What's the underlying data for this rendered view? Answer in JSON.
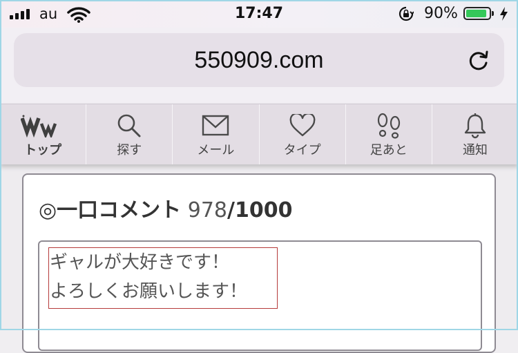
{
  "status_bar": {
    "carrier": "au",
    "time": "17:47",
    "battery_percent": "90%",
    "battery_level": 0.9,
    "signal_bars": 4,
    "battery_color": "#35c85a"
  },
  "browser": {
    "url": "550909.com"
  },
  "nav": {
    "items": [
      {
        "label": "トップ",
        "icon": "ww-logo-icon"
      },
      {
        "label": "探す",
        "icon": "search-icon"
      },
      {
        "label": "メール",
        "icon": "mail-icon"
      },
      {
        "label": "タイプ",
        "icon": "heart-icon"
      },
      {
        "label": "足あと",
        "icon": "footprints-icon"
      },
      {
        "label": "通知",
        "icon": "bell-icon"
      }
    ]
  },
  "comment": {
    "title": "◎一口コメント",
    "count": "978",
    "max": "/1000",
    "text": "ギャルが大好きです！\nよろしくお願いします！"
  },
  "colors": {
    "highlight_border": "#b53a3a",
    "frame_border": "#9fd6e6"
  }
}
